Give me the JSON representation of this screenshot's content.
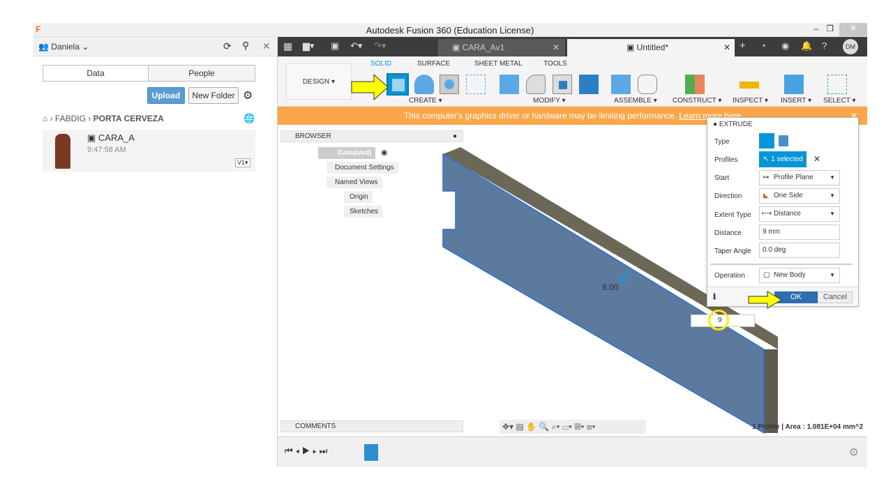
{
  "window": {
    "title": "Autodesk Fusion 360 (Education License)",
    "app_icon": "F"
  },
  "left_panel": {
    "user": "Daniela",
    "tabs": [
      "Data",
      "People"
    ],
    "upload": "Upload",
    "new_folder": "New Folder",
    "breadcrumb": [
      "FABDIG",
      "PORTA CERVEZA"
    ],
    "files": [
      {
        "name": "CARA_A",
        "time": "9:47:58 AM",
        "version": "V1"
      }
    ]
  },
  "doc_tabs": [
    {
      "label": "CARA_Av1"
    },
    {
      "label": "Untitled*"
    }
  ],
  "user_initials": "DM",
  "ribbon": {
    "workspace": "DESIGN",
    "tabs": [
      "SOLID",
      "SURFACE",
      "SHEET METAL",
      "TOOLS"
    ],
    "active_tab": "SOLID",
    "groups": [
      "CREATE",
      "MODIFY",
      "ASSEMBLE",
      "CONSTRUCT",
      "INSPECT",
      "INSERT",
      "SELECT"
    ]
  },
  "warning": {
    "text": "This computer's graphics driver or hardware may be limiting performance.",
    "link": "Learn more here"
  },
  "browser": {
    "title": "BROWSER",
    "root": "(Unsaved)",
    "items": [
      "Document Settings",
      "Named Views",
      "Origin",
      "Sketches"
    ]
  },
  "comments": "COMMENTS",
  "viewport": {
    "dim_label": "9.00",
    "input_value": "9",
    "status": "1 Profile | Area : 1.081E+04 mm^2"
  },
  "extrude": {
    "title": "EXTRUDE",
    "rows": [
      {
        "label": "Type"
      },
      {
        "label": "Profiles",
        "value": "1 selected"
      },
      {
        "label": "Start",
        "value": "Profile Plane"
      },
      {
        "label": "Direction",
        "value": "One Side"
      },
      {
        "label": "Extent Type",
        "value": "Distance"
      },
      {
        "label": "Distance",
        "value": "9 mm"
      },
      {
        "label": "Taper Angle",
        "value": "0.0 deg"
      },
      {
        "label": "Operation",
        "value": "New Body"
      }
    ],
    "ok": "OK",
    "cancel": "Cancel"
  },
  "colors": {
    "accent": "#0696d7",
    "warning": "#f9a74a",
    "highlight": "#ffff00",
    "body": "#5b7a9e"
  }
}
